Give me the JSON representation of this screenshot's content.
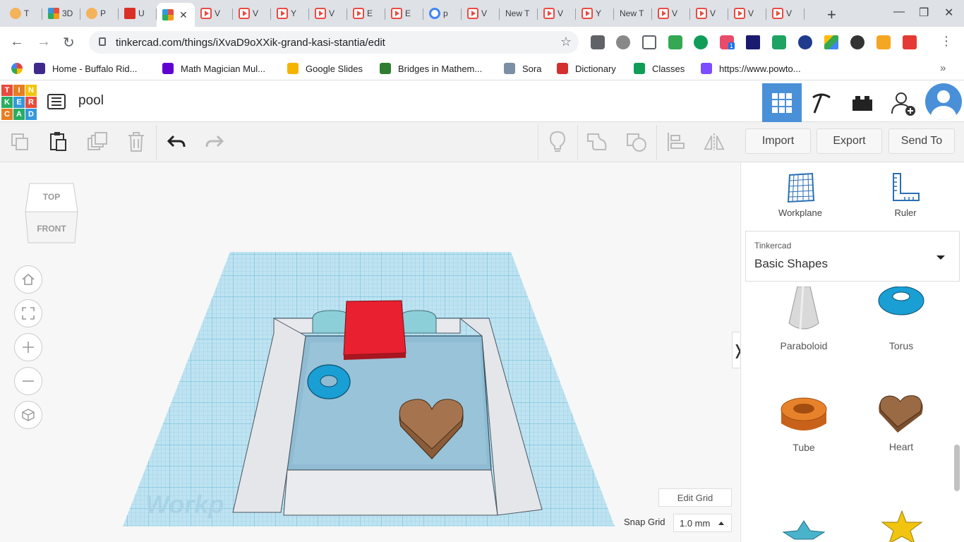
{
  "browser": {
    "tabs": [
      {
        "label": "T",
        "icon": "face"
      },
      {
        "label": "3D",
        "icon": "tinkercad"
      },
      {
        "label": "P",
        "icon": "face"
      },
      {
        "label": "U",
        "icon": "clapper"
      },
      {
        "label": "",
        "icon": "tinkercad",
        "active": true
      },
      {
        "label": "V",
        "icon": "play"
      },
      {
        "label": "V",
        "icon": "play"
      },
      {
        "label": "Y",
        "icon": "play"
      },
      {
        "label": "V",
        "icon": "play"
      },
      {
        "label": "E",
        "icon": "play"
      },
      {
        "label": "E",
        "icon": "play"
      },
      {
        "label": "p",
        "icon": "google"
      },
      {
        "label": "V",
        "icon": "play"
      },
      {
        "label": "New T",
        "icon": "none"
      },
      {
        "label": "V",
        "icon": "play"
      },
      {
        "label": "Y",
        "icon": "play"
      },
      {
        "label": "New T",
        "icon": "none"
      },
      {
        "label": "V",
        "icon": "play"
      },
      {
        "label": "V",
        "icon": "play"
      },
      {
        "label": "V",
        "icon": "play"
      },
      {
        "label": "V",
        "icon": "play"
      }
    ],
    "url": "tinkercad.com/things/iXvaD9oXXik-grand-kasi-stantia/edit",
    "extension_badge": "1",
    "bookmarks": [
      {
        "label": "Home - Buffalo Rid...",
        "color": "#3f2a8c"
      },
      {
        "label": "Math Magician Mul...",
        "color": "#6001d2"
      },
      {
        "label": "Google Slides",
        "color": "#f4b400"
      },
      {
        "label": "Bridges in Mathem...",
        "color": "#2e7d32"
      },
      {
        "label": "Sora",
        "color": "#7b8fa6"
      },
      {
        "label": "Dictionary",
        "color": "#d32f2f"
      },
      {
        "label": "Classes",
        "color": "#0f9d58"
      },
      {
        "label": "https://www.powto...",
        "color": "#7c4dff"
      }
    ]
  },
  "app": {
    "logo_letters": [
      "T",
      "I",
      "N",
      "K",
      "E",
      "R",
      "C",
      "A",
      "D"
    ],
    "logo_colors": [
      "#e74c3c",
      "#e67e22",
      "#f1c40f",
      "#27ae60",
      "#3498db",
      "#e74c3c",
      "#e67e22",
      "#27ae60",
      "#3498db"
    ],
    "design_title": "pool",
    "accent": "#4a90d9"
  },
  "toolbar": {
    "import_label": "Import",
    "export_label": "Export",
    "send_to_label": "Send To"
  },
  "workspace": {
    "viewcube_top": "TOP",
    "viewcube_front": "FRONT",
    "workplane_watermark": "Workp",
    "edit_grid_label": "Edit Grid",
    "snap_grid_label": "Snap Grid",
    "snap_grid_value": "1.0 mm"
  },
  "panel": {
    "workplane_label": "Workplane",
    "ruler_label": "Ruler",
    "category_source": "Tinkercad",
    "category_name": "Basic Shapes",
    "shapes": [
      {
        "label": "Paraboloid",
        "color": "#d8d8d8"
      },
      {
        "label": "Torus",
        "color": "#1a9fd4"
      },
      {
        "label": "Tube",
        "color": "#e8822a"
      },
      {
        "label": "Heart",
        "color": "#9a6a44"
      }
    ]
  }
}
